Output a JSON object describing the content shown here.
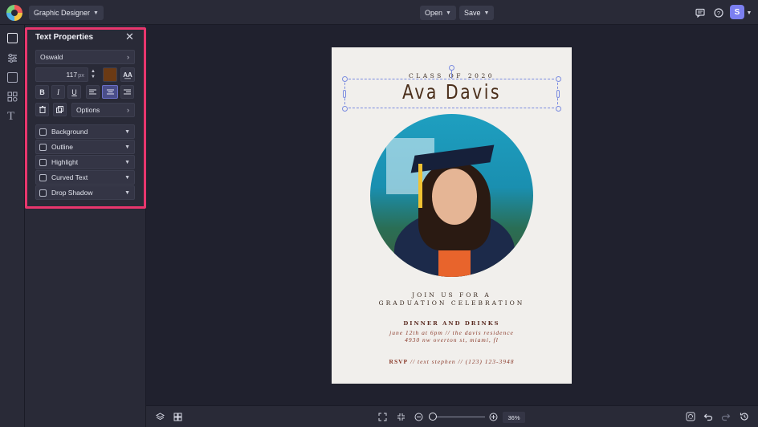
{
  "topbar": {
    "app_menu_label": "Graphic Designer",
    "open_label": "Open",
    "save_label": "Save",
    "avatar_initial": "S"
  },
  "panel": {
    "title": "Text Properties",
    "font_name": "Oswald",
    "font_size": "117",
    "font_size_unit": "px",
    "text_color": "#6b3a14",
    "options_label": "Options",
    "effects": [
      {
        "label": "Background"
      },
      {
        "label": "Outline"
      },
      {
        "label": "Highlight"
      },
      {
        "label": "Curved Text"
      },
      {
        "label": "Drop Shadow"
      }
    ]
  },
  "design": {
    "class_of": "CLASS OF 2020",
    "name": "Ava Davis",
    "join_line1": "JOIN US FOR A",
    "join_line2": "GRADUATION CELEBRATION",
    "dinner": "DINNER AND DRINKS",
    "detail_line1": "june 12th at 6pm // the davis residence",
    "detail_line2": "4930 nw overton st, miami, fl",
    "rsvp_label": "RSVP",
    "rsvp_text": "// text stephen // (123) 123-3948"
  },
  "zoom": {
    "level_label": "36%"
  },
  "colors": {
    "accent_highlight": "#e8366d",
    "selection": "#7b8ce0",
    "avatar_bg": "#7b7ff0"
  }
}
